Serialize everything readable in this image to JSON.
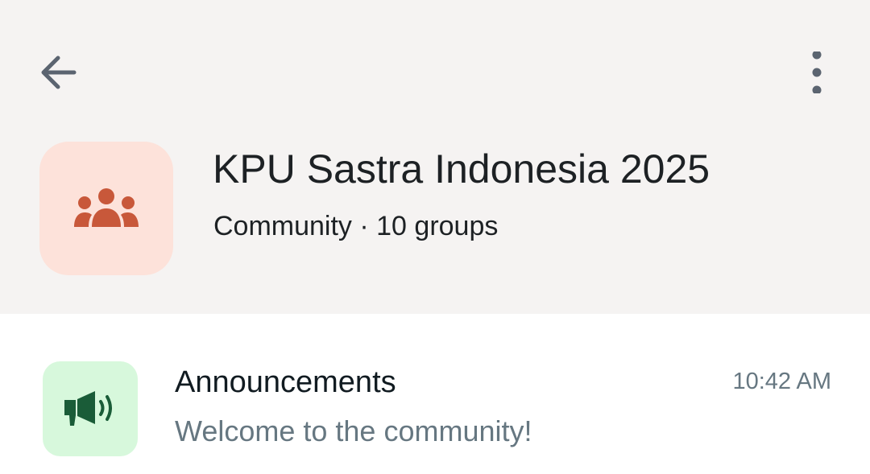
{
  "header": {
    "back_icon": "arrow-left-icon",
    "menu_icon": "more-vertical-icon",
    "community_icon": "group-icon",
    "title": "KPU Sastra Indonesia 2025",
    "subtitle": "Community · 10 groups",
    "colors": {
      "background": "#f5f3f2",
      "avatar_bg": "#fde2da",
      "avatar_icon": "#c8583a"
    }
  },
  "chats": [
    {
      "icon": "megaphone-icon",
      "name": "Announcements",
      "preview": "Welcome to the community!",
      "time": "10:42 AM",
      "colors": {
        "avatar_bg": "#d7f8dc",
        "avatar_icon": "#1a5c38"
      }
    }
  ]
}
